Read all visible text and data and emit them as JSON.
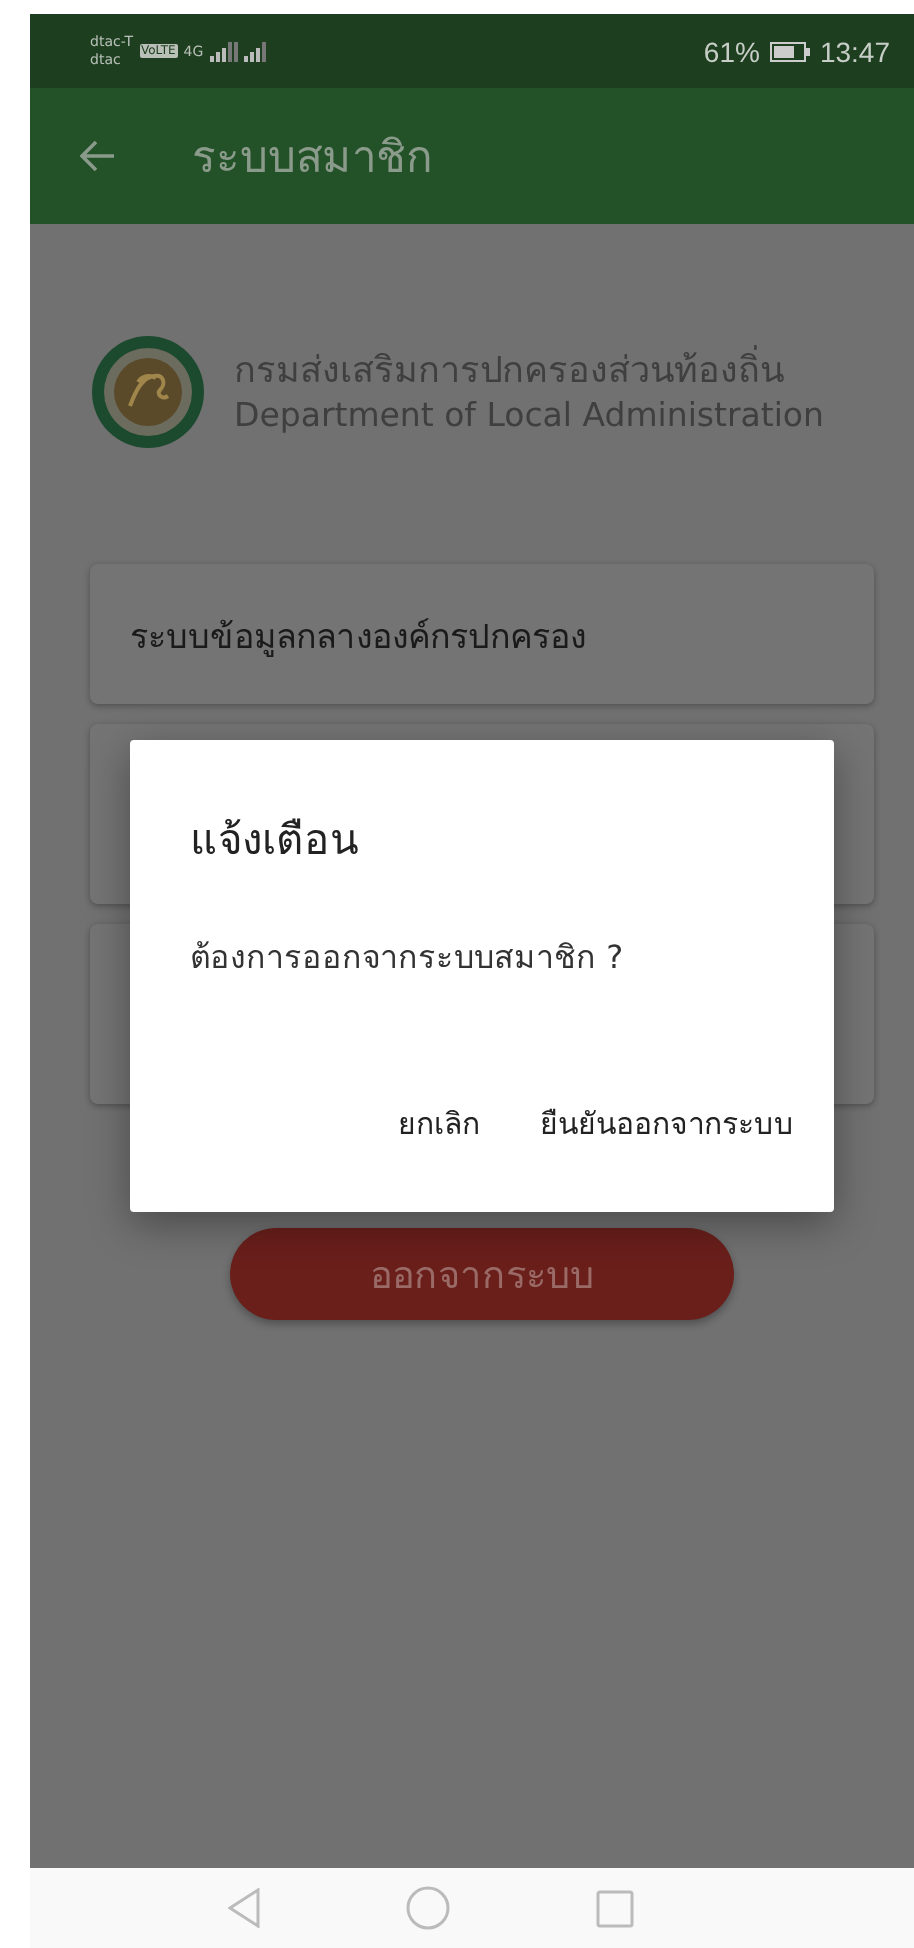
{
  "status_bar": {
    "carrier_1": "dtac-T",
    "carrier_2": "dtac",
    "volte_badge": "VoLTE",
    "network": "4G",
    "battery_percent": "61%",
    "time": "13:47"
  },
  "app_bar": {
    "title": "ระบบสมาชิก"
  },
  "header": {
    "org_name_thai": "กรมส่งเสริมการปกครองส่วนท้องถิ่น",
    "org_name_english": "Department of Local Administration"
  },
  "menu_cards": [
    {
      "kind": "text",
      "label": "ระบบข้อมูลกลางองค์กรปกครอง"
    },
    {
      "kind": "covered"
    },
    {
      "kind": "covered"
    }
  ],
  "logout_button": {
    "label": "ออกจากระบบ"
  },
  "dialog": {
    "title": "แจ้งเตือน",
    "message": "ต้องการออกจากระบบสมาชิก ?",
    "buttons": [
      "ยกเลิก",
      "ยืนยันออกจากระบบ"
    ]
  }
}
